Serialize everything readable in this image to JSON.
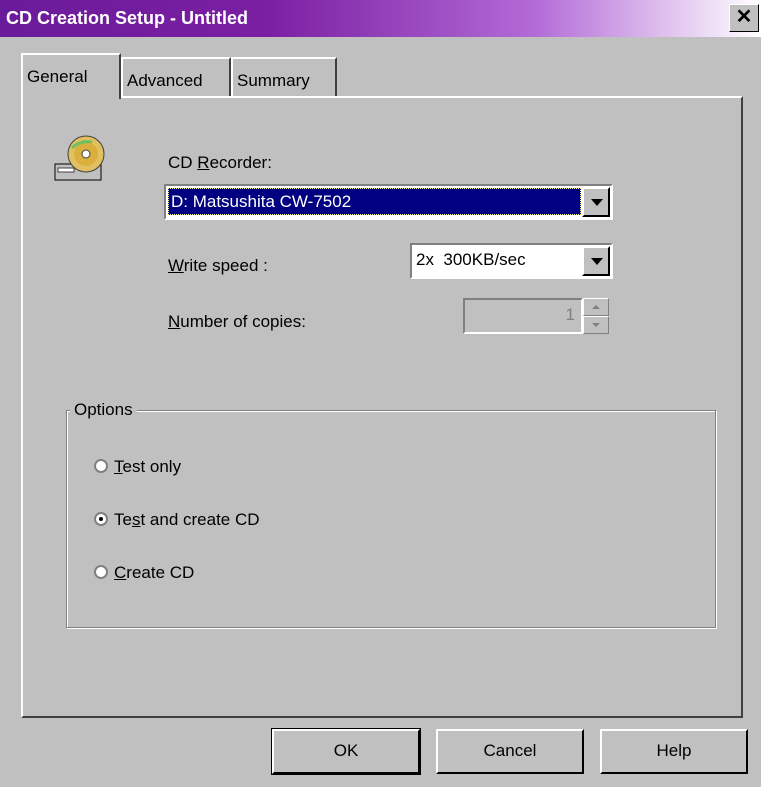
{
  "window": {
    "title": "CD Creation Setup - Untitled",
    "close_glyph": "✕"
  },
  "tabs": [
    {
      "label": "General",
      "active": true
    },
    {
      "label": "Advanced",
      "active": false
    },
    {
      "label": "Summary",
      "active": false
    }
  ],
  "recorder": {
    "label_pre": "CD ",
    "label_mnemonic": "R",
    "label_post": "ecorder:",
    "value": "D: Matsushita CW-7502",
    "icon": "cd-recorder-icon"
  },
  "write_speed": {
    "label_mnemonic": "W",
    "label_post": "rite speed :",
    "value": "2x  300KB/sec"
  },
  "copies": {
    "label_mnemonic": "N",
    "label_post": "umber of copies:",
    "value": "1"
  },
  "options": {
    "legend": "Options",
    "items": [
      {
        "pre": "",
        "mnemonic": "T",
        "post": "est only",
        "selected": false
      },
      {
        "pre": "Te",
        "mnemonic": "s",
        "post": "t and create CD",
        "selected": true
      },
      {
        "pre": "",
        "mnemonic": "C",
        "post": "reate CD",
        "selected": false
      }
    ]
  },
  "buttons": {
    "ok": "OK",
    "cancel": "Cancel",
    "help": "Help"
  },
  "colors": {
    "face": "#c0c0c0",
    "title_start": "#6a1b9a",
    "selection": "#000080"
  }
}
